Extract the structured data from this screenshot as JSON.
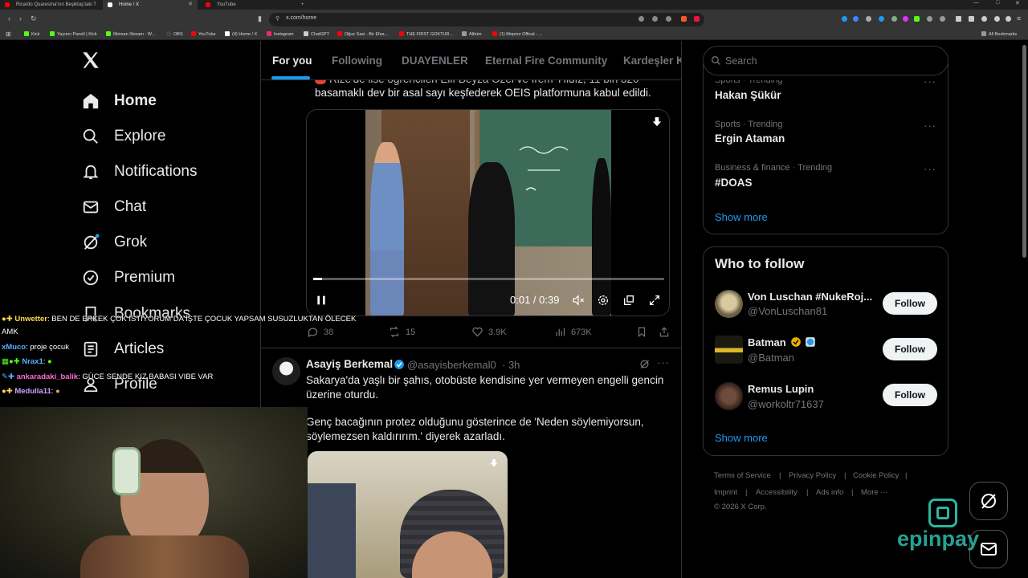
{
  "browser": {
    "tabs": [
      {
        "label": "Ricardo Quaresma'nın Beşiktaş'taki T",
        "color": "#ff0000"
      },
      {
        "label": "Home / X",
        "color": "#ffffff"
      },
      {
        "label": "YouTube",
        "color": "#ff0000"
      }
    ],
    "new_tab": "+",
    "url": "x.com/home",
    "bookmarks": [
      {
        "label": "Kick",
        "color": "#53fc18"
      },
      {
        "label": "Yayıncı Paneli | Kick",
        "color": "#53fc18"
      },
      {
        "label": "İlkinsan Stream - W...",
        "color": "#53fc18"
      },
      {
        "label": "OBS",
        "color": "#333333"
      },
      {
        "label": "YouTube",
        "color": "#ff0000"
      },
      {
        "label": "(4) Home / X",
        "color": "#ffffff"
      },
      {
        "label": "Instagram",
        "color": "#e1306c"
      },
      {
        "label": "ChatGPT",
        "color": "#cccccc"
      },
      {
        "label": "Oğuz Sasi - Bir Efsa...",
        "color": "#ff0000"
      },
      {
        "label": "THE FIRST GOKTUR...",
        "color": "#ff0000"
      },
      {
        "label": "Albüm",
        "color": "#999999"
      },
      {
        "label": "(1) Meprez Offical - ...",
        "color": "#ff0000"
      }
    ],
    "all_bookmarks": "All Bookmarks"
  },
  "nav": {
    "items": [
      {
        "label": "Home"
      },
      {
        "label": "Explore"
      },
      {
        "label": "Notifications"
      },
      {
        "label": "Chat"
      },
      {
        "label": "Grok"
      },
      {
        "label": "Premium"
      },
      {
        "label": "Bookmarks"
      },
      {
        "label": "Articles"
      },
      {
        "label": "Profile"
      }
    ]
  },
  "feed": {
    "tabs": [
      "For you",
      "Following",
      "DUAYENLER",
      "Eternal Fire Community",
      "Kardeşler Ki"
    ],
    "post1": {
      "text_line1": "Rize'de lise öğrencileri Elif Beyza Özel ve İrem Yıldız, 11 bin 320",
      "text_line2": "basamaklı dev bir asal sayı keşfederek OEIS platformuna kabul edildi.",
      "video_time": "0:01 / 0:39",
      "progress": 0.025,
      "replies": "38",
      "reposts": "15",
      "likes": "3.9K",
      "views": "673K"
    },
    "post2": {
      "author": "Asayiş Berkemal",
      "handle": "@asayisberkemal0",
      "time": "· 3h",
      "line1": "Sakarya'da yaşlı bir şahıs, otobüste kendisine yer vermeyen engelli gencin",
      "line2": "üzerine oturdu.",
      "line3": "Genç bacağının protez olduğunu gösterince de 'Neden söylemiyorsun,",
      "line4": "söylemezsen kaldırırım.' diyerek azarladı."
    }
  },
  "search": {
    "placeholder": "Search"
  },
  "trends": [
    {
      "meta": "Sports · Trending",
      "title": "Hakan Şükür"
    },
    {
      "meta": "Sports · Trending",
      "title": "Ergin Ataman"
    },
    {
      "meta": "Business & finance · Trending",
      "title": "#DOAS"
    }
  ],
  "trends_show_more": "Show more",
  "who_to_follow": {
    "title": "Who to follow",
    "users": [
      {
        "name": "Von Luschan #NukeRoj...",
        "handle": "@VonLuschan81",
        "button": "Follow"
      },
      {
        "name": "Batman",
        "handle": "@Batman",
        "button": "Follow"
      },
      {
        "name": "Remus Lupin",
        "handle": "@workoltr71637",
        "button": "Follow"
      }
    ],
    "show_more": "Show more"
  },
  "footer": {
    "links": [
      "Terms of Service",
      "Privacy Policy",
      "Cookie Policy",
      "Imprint",
      "Accessibility",
      "Ads info",
      "More ···"
    ],
    "copyright": "© 2026 X Corp."
  },
  "overlay": {
    "chat": [
      {
        "user": "Unwetter",
        "user_color": "#ffd84d",
        "msg": ": BEN DE ERKEK ÇOK İSTİYORUM DA İŞTE ÇOCUK YAPSAM SUSUZLUKTAN ÖLECEK"
      },
      {
        "user": "",
        "user_color": "#ffffff",
        "msg": "AMK"
      },
      {
        "user": "xMuco",
        "user_color": "#5ab0ff",
        "msg": ": proje çocuk"
      },
      {
        "user": "Nrax1",
        "user_color": "#5ab0ff",
        "msg": ":"
      },
      {
        "user": "ankaradaki_balik",
        "user_color": "#ff6ad5",
        "msg": ": GÜCE SENDE KIZ BABASI VIBE VAR"
      },
      {
        "user": "Medulla11",
        "user_color": "#c9a2ff",
        "msg": ":"
      }
    ],
    "sponsor": "epinpay"
  }
}
